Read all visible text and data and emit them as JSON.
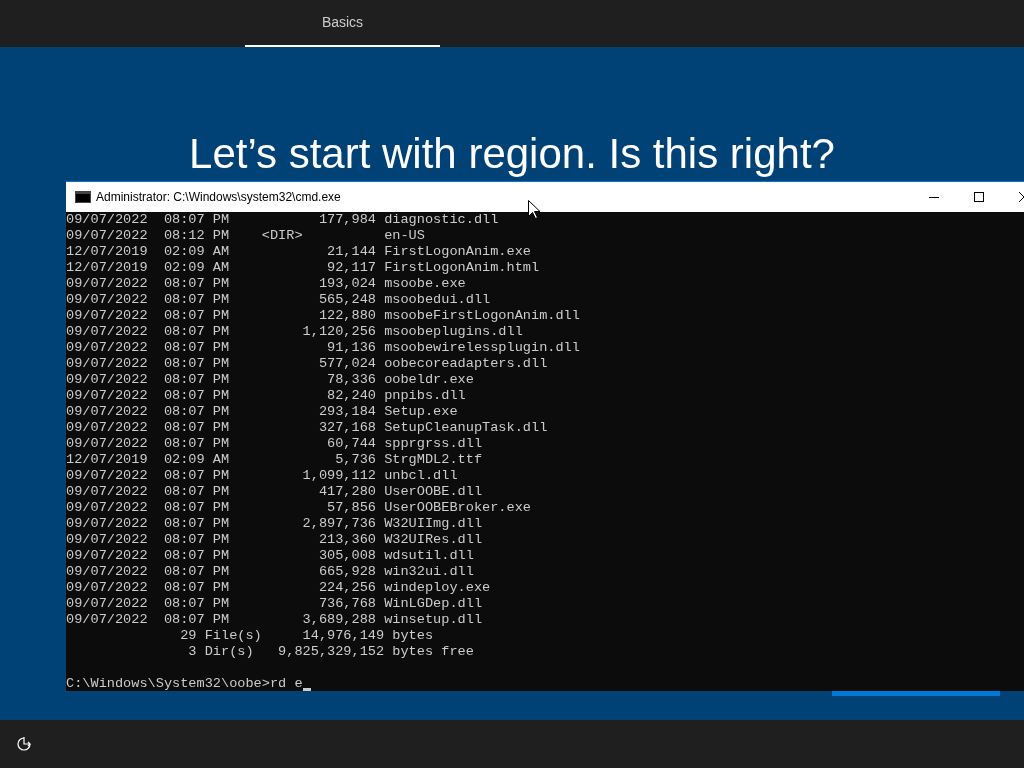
{
  "tabs": [
    {
      "label": "Basics",
      "selected": true
    }
  ],
  "heading": "Let’s start with region. Is this right?",
  "console_window": {
    "title": "Administrator: C:\\Windows\\system32\\cmd.exe",
    "lines": [
      "09/07/2022  08:07 PM           177,984 diagnostic.dll",
      "09/07/2022  08:12 PM    <DIR>          en-US",
      "12/07/2019  02:09 AM            21,144 FirstLogonAnim.exe",
      "12/07/2019  02:09 AM            92,117 FirstLogonAnim.html",
      "09/07/2022  08:07 PM           193,024 msoobe.exe",
      "09/07/2022  08:07 PM           565,248 msoobedui.dll",
      "09/07/2022  08:07 PM           122,880 msoobeFirstLogonAnim.dll",
      "09/07/2022  08:07 PM         1,120,256 msoobeplugins.dll",
      "09/07/2022  08:07 PM            91,136 msoobewirelessplugin.dll",
      "09/07/2022  08:07 PM           577,024 oobecoreadapters.dll",
      "09/07/2022  08:07 PM            78,336 oobeldr.exe",
      "09/07/2022  08:07 PM            82,240 pnpibs.dll",
      "09/07/2022  08:07 PM           293,184 Setup.exe",
      "09/07/2022  08:07 PM           327,168 SetupCleanupTask.dll",
      "09/07/2022  08:07 PM            60,744 spprgrss.dll",
      "12/07/2019  02:09 AM             5,736 StrgMDL2.ttf",
      "09/07/2022  08:07 PM         1,099,112 unbcl.dll",
      "09/07/2022  08:07 PM           417,280 UserOOBE.dll",
      "09/07/2022  08:07 PM            57,856 UserOOBEBroker.exe",
      "09/07/2022  08:07 PM         2,897,736 W32UIImg.dll",
      "09/07/2022  08:07 PM           213,360 W32UIRes.dll",
      "09/07/2022  08:07 PM           305,008 wdsutil.dll",
      "09/07/2022  08:07 PM           665,928 win32ui.dll",
      "09/07/2022  08:07 PM           224,256 windeploy.exe",
      "09/07/2022  08:07 PM           736,768 WinLGDep.dll",
      "09/07/2022  08:07 PM         3,689,288 winsetup.dll",
      "              29 File(s)     14,976,149 bytes",
      "               3 Dir(s)   9,825,329,152 bytes free"
    ],
    "prompt": "C:\\Windows\\System32\\oobe>rd e"
  }
}
